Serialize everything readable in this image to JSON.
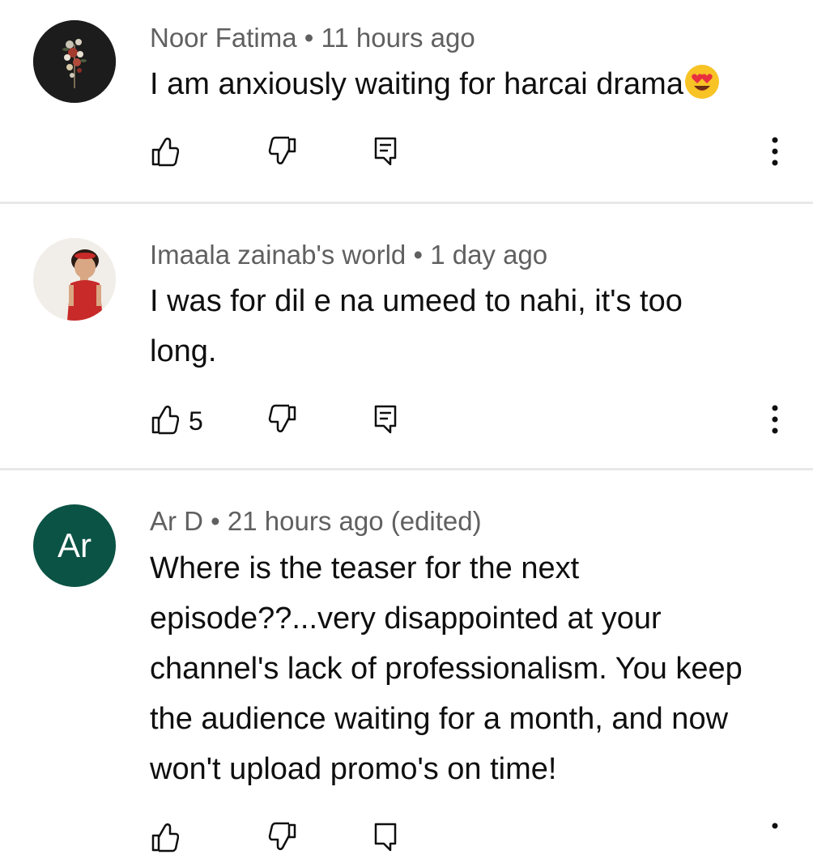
{
  "comments": [
    {
      "author": "Noor Fatima",
      "sep": "•",
      "time": "11 hours ago",
      "text": "I am anxiously waiting for harcai drama",
      "emoji": "smiling-face-with-heart-eyes",
      "likes": "",
      "avatar": "photo"
    },
    {
      "author": "Imaala zainab's world",
      "sep": "•",
      "time": "1 day ago",
      "text": "I was for dil e na umeed to nahi, it's too long.",
      "likes": "5",
      "avatar": "photo"
    },
    {
      "author": "Ar D",
      "sep": "•",
      "time": "21 hours ago (edited)",
      "text": "Where is the teaser for the next episode??...very disappointed at your channel's lack of professionalism. You keep the audience waiting for a month, and now won't upload promo's on time!",
      "likes": "",
      "avatar_initials": "Ar",
      "avatar_color": "#0b5345"
    }
  ],
  "icons": {
    "like": "thumbs-up-icon",
    "dislike": "thumbs-down-icon",
    "reply": "reply-comment-icon",
    "more": "more-vertical-icon"
  }
}
